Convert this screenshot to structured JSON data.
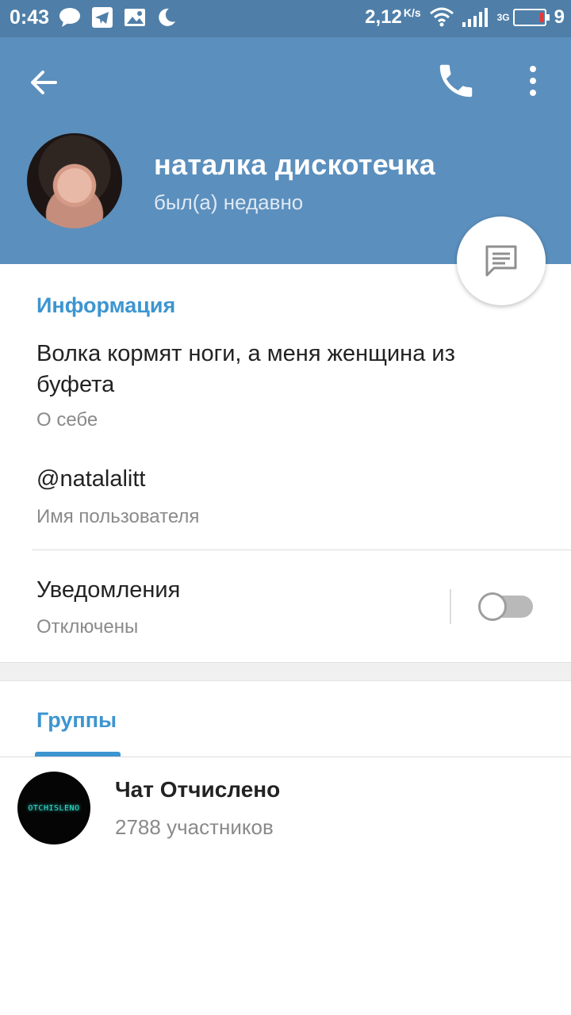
{
  "status_bar": {
    "time": "0:43",
    "speed": "2,12",
    "speed_unit": "K/s",
    "network": "3G",
    "battery": "9"
  },
  "header": {
    "name": "наталка дискотечка",
    "status": "был(а) недавно"
  },
  "info": {
    "section_title": "Информация",
    "bio": "Волка кормят ноги, а меня женщина из буфета",
    "bio_label": "О себе",
    "username": "@natalalitt",
    "username_label": "Имя пользователя",
    "notifications_title": "Уведомления",
    "notifications_state": "Отключены",
    "notifications_enabled": false
  },
  "groups": {
    "tab_title": "Группы",
    "items": [
      {
        "name": "Чат Отчислено",
        "members": "2788 участников",
        "avatar_text": "OTCHISLENO"
      }
    ]
  },
  "colors": {
    "header": "#5b8fbd",
    "status_bar": "#4f7fa8",
    "accent": "#3d95d0"
  }
}
